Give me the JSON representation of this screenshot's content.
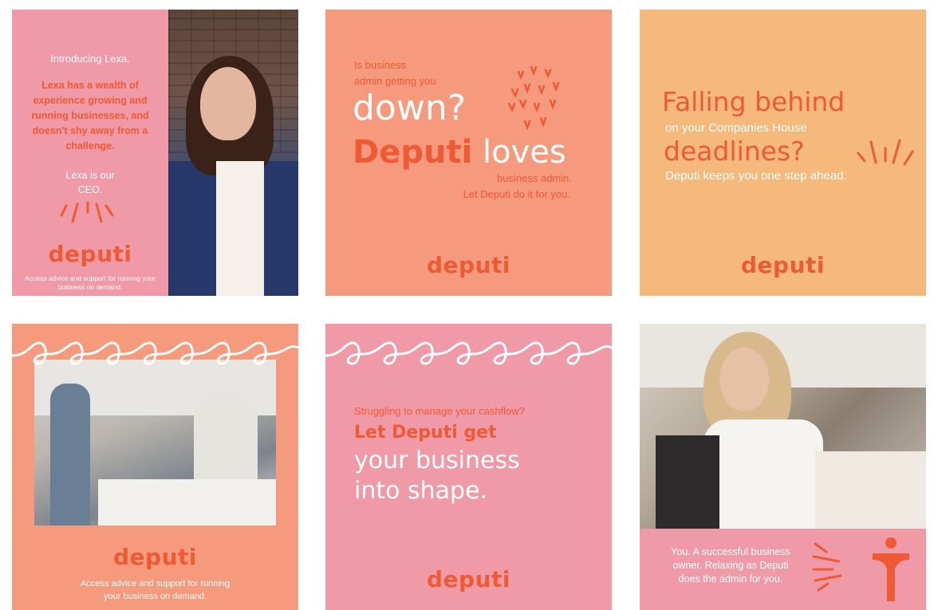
{
  "brand": {
    "logo_text": "deputi",
    "color": "#ee5a33"
  },
  "tiles": {
    "t1": {
      "intro": "Introducing Lexa.",
      "body": [
        "Lexa has a wealth of",
        "experience growing and",
        "running businesses, and",
        "doesn't shy away from a",
        "challenge."
      ],
      "role": [
        "Lexa is our",
        "CEO."
      ],
      "tagline": [
        "Access advice and support for running your",
        "business on demand."
      ]
    },
    "t2": {
      "line1": "Is business",
      "line2": "admin getting you",
      "big1": "down?",
      "big2a": "Deputi",
      "big2b": "loves",
      "line3": "business admin.",
      "line4": "Let Deputi do it for you."
    },
    "t3": {
      "big1": "Falling behind",
      "line1": "on your Companies House",
      "big2": "deadlines?",
      "line2": "Deputi keeps you one step ahead."
    },
    "t4": {
      "tagline": [
        "Access advice and support for running",
        "your business on demand."
      ]
    },
    "t5": {
      "line1": "Struggling to manage your cashflow?",
      "big1": "Let Deputi get",
      "big2": "your business",
      "big3": "into shape."
    },
    "t6": {
      "text": [
        "You. A successful business",
        "owner. Relaxing as Deputi",
        "does the admin for you."
      ]
    }
  }
}
